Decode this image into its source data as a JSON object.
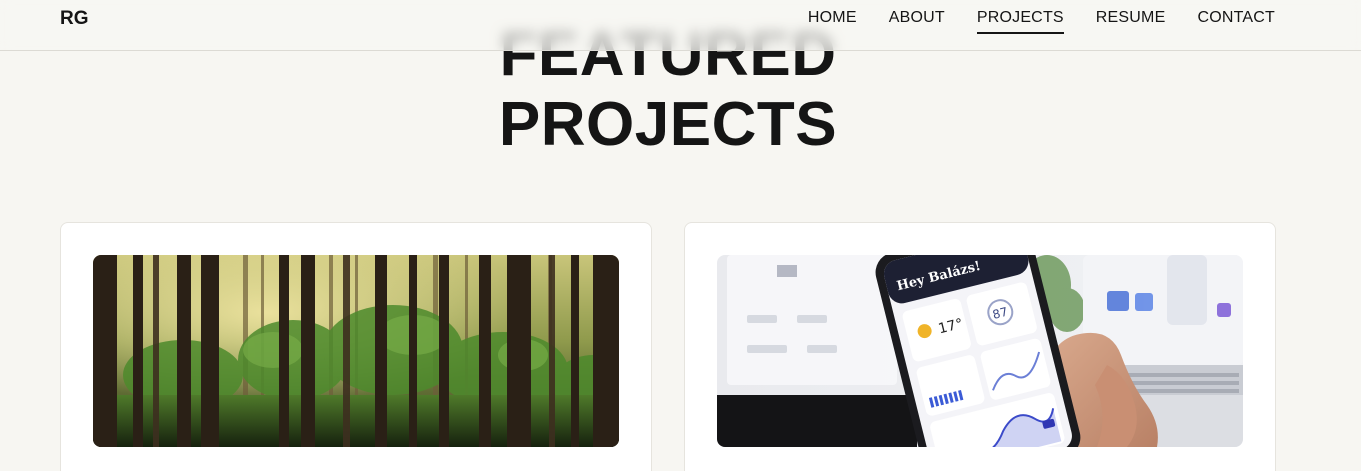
{
  "header": {
    "logo": "RG",
    "nav": [
      {
        "label": "HOME",
        "active": false
      },
      {
        "label": "ABOUT",
        "active": false
      },
      {
        "label": "PROJECTS",
        "active": true
      },
      {
        "label": "RESUME",
        "active": false
      },
      {
        "label": "CONTACT",
        "active": false
      }
    ]
  },
  "hero": {
    "title_line1": "FEATURED",
    "title_line2": "PROJECTS"
  },
  "projects": [
    {
      "image": "forest-photo"
    },
    {
      "image": "phone-weather-app-photo",
      "app_greeting": "Hey Balázs!",
      "app_temperature": "17°",
      "app_air_quality": "87"
    }
  ]
}
